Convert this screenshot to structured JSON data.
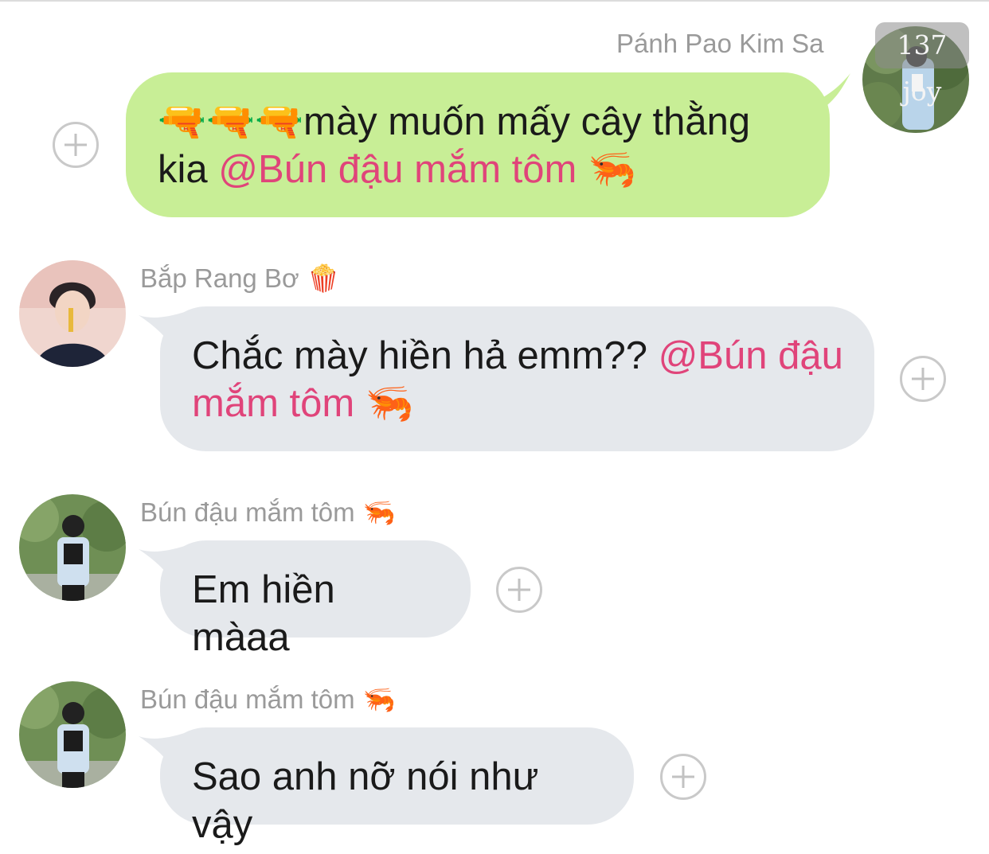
{
  "messages": [
    {
      "sender": "Pánh Pao Kim Sa",
      "badge": "137 joy",
      "text_emoji": "🔫🔫🔫",
      "text_before": "mày muốn mấy cây thằng kia ",
      "mention": "@Bún đậu mắm tôm",
      "mention_emoji": "🦐",
      "direction": "outgoing"
    },
    {
      "sender": "Bắp Rang Bơ",
      "sender_emoji": "🍿",
      "text_before": "Chắc mày hiền hả emm?? ",
      "mention": "@Bún đậu mắm tôm",
      "mention_emoji": "🦐",
      "direction": "incoming"
    },
    {
      "sender": "Bún đậu mắm tôm",
      "sender_emoji": "🦐",
      "text": "Em hiền màaa",
      "direction": "incoming"
    },
    {
      "sender": "Bún đậu mắm tôm",
      "sender_emoji": "🦐",
      "text": "Sao anh nỡ nói như vậy",
      "direction": "incoming"
    }
  ],
  "colors": {
    "outgoing_bubble": "#c8ee96",
    "incoming_bubble": "#e5e8ec",
    "mention": "#e0447a",
    "name": "#9a9a9a"
  },
  "icons": {
    "add": "plus-circle-icon",
    "gun": "water-pistol-icon",
    "shrimp": "shrimp-icon",
    "popcorn": "popcorn-icon"
  }
}
